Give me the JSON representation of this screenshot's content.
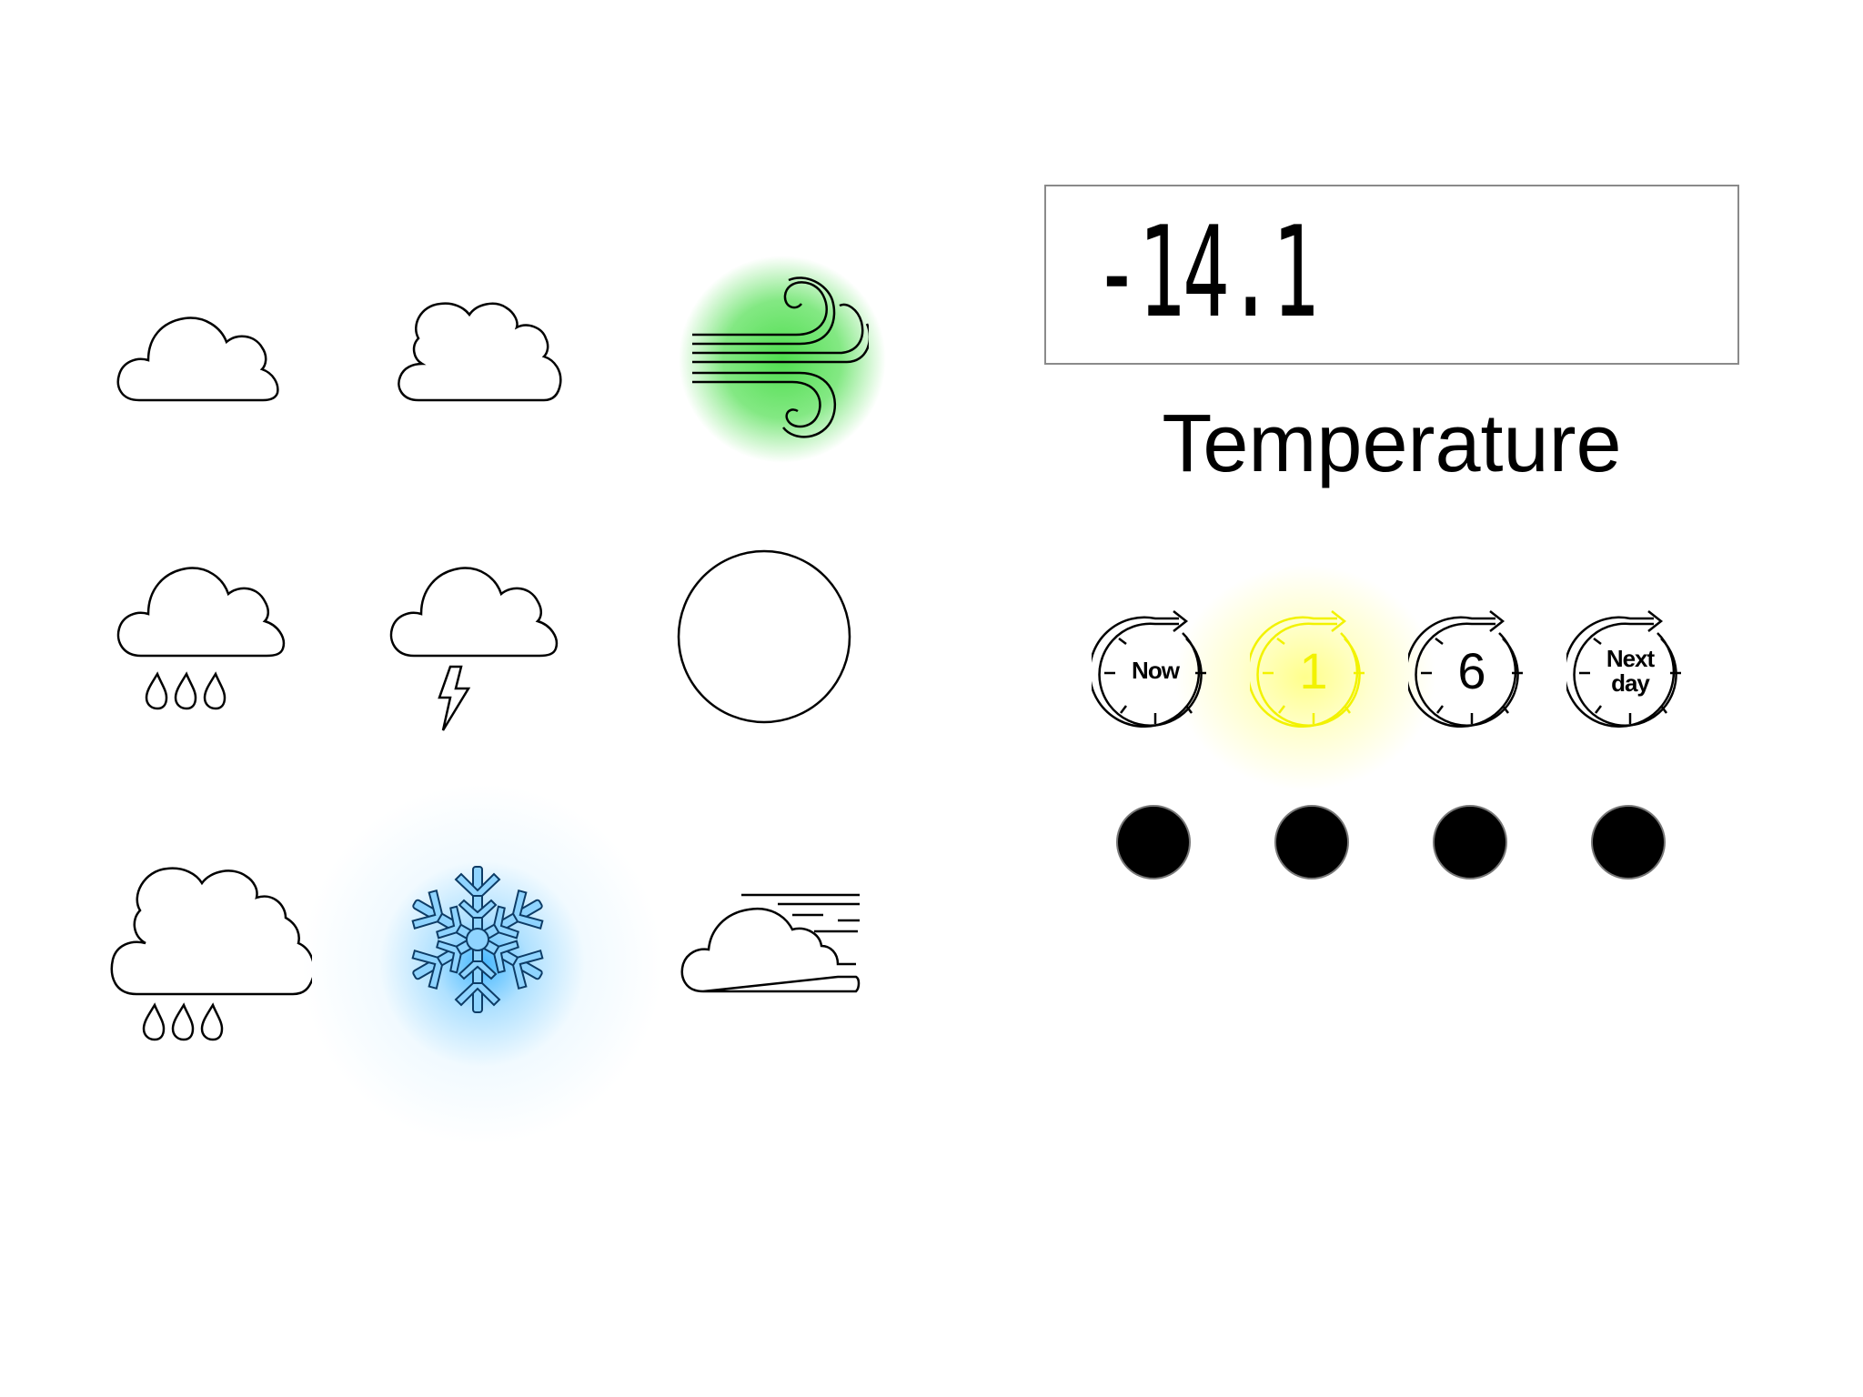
{
  "weather_icons": [
    {
      "name": "cloud-icon",
      "highlight": null
    },
    {
      "name": "cloud-icon-alt",
      "highlight": null
    },
    {
      "name": "wind-icon",
      "highlight": "#55dd55"
    },
    {
      "name": "rain-cloud-icon",
      "highlight": null
    },
    {
      "name": "thunderstorm-icon",
      "highlight": null
    },
    {
      "name": "clear-sun-icon",
      "highlight": null
    },
    {
      "name": "heavy-rain-icon",
      "highlight": null
    },
    {
      "name": "snowflake-icon",
      "highlight": "#4ab8f5"
    },
    {
      "name": "windy-cloud-icon",
      "highlight": null
    }
  ],
  "display": {
    "value": "-14.1",
    "label": "Temperature"
  },
  "time_dials": [
    {
      "name": "clock-icon-now",
      "label": "Now",
      "active": false
    },
    {
      "name": "clock-icon-1",
      "label": "1",
      "active": true,
      "active_color": "#f2f200"
    },
    {
      "name": "clock-icon-6",
      "label": "6",
      "active": false
    },
    {
      "name": "clock-icon-next-day",
      "label": "Next\nday",
      "active": false
    }
  ],
  "indicators": [
    {
      "color": "#000000"
    },
    {
      "color": "#000000"
    },
    {
      "color": "#000000"
    },
    {
      "color": "#000000"
    }
  ]
}
